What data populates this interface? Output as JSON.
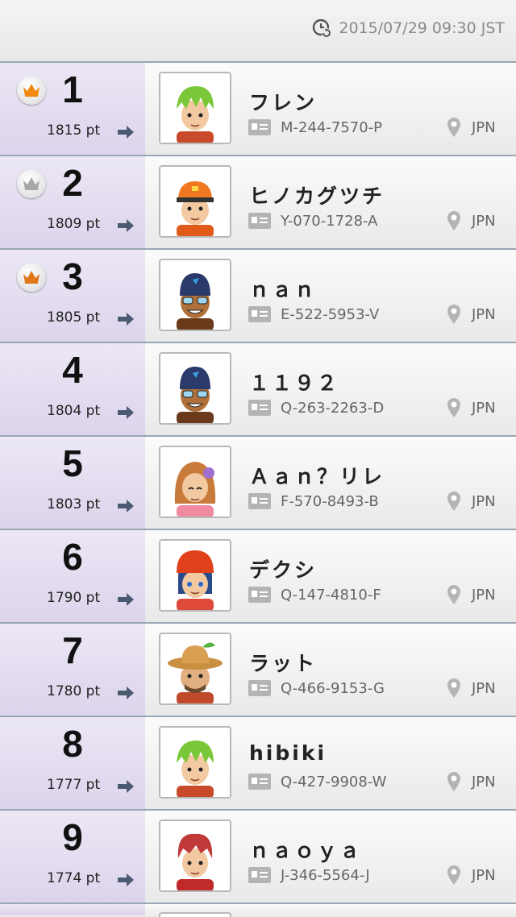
{
  "header": {
    "timestamp": "2015/07/29 09:30 JST",
    "icon": "clock-refresh-icon"
  },
  "colors": {
    "gold_crown": "#f08a10",
    "silver_crown": "#a8a8a8",
    "bronze_crown": "#e07818",
    "rank_bg": "#e3ddf0",
    "divider": "#9aa6b4"
  },
  "rankings": [
    {
      "rank": "1",
      "points": "1815 pt",
      "name": "フレン",
      "id": "M-244-7570-P",
      "country": "JPN",
      "crown": "gold",
      "avatar": "green-hair-boy"
    },
    {
      "rank": "2",
      "points": "1809 pt",
      "name": "ヒノカグツチ",
      "id": "Y-070-1728-A",
      "country": "JPN",
      "crown": "silver",
      "avatar": "orange-cap-boy"
    },
    {
      "rank": "3",
      "points": "1805 pt",
      "name": "ｎａｎ",
      "id": "E-522-5953-V",
      "country": "JPN",
      "crown": "bronze",
      "avatar": "swimmer-goggles"
    },
    {
      "rank": "4",
      "points": "1804 pt",
      "name": "１１９２",
      "id": "Q-263-2263-D",
      "country": "JPN",
      "crown": "",
      "avatar": "swimmer-goggles"
    },
    {
      "rank": "5",
      "points": "1803 pt",
      "name": "Ａａｎ？リレ",
      "id": "F-570-8493-B",
      "country": "JPN",
      "crown": "",
      "avatar": "flower-girl"
    },
    {
      "rank": "6",
      "points": "1790 pt",
      "name": "デクシ",
      "id": "Q-147-4810-F",
      "country": "JPN",
      "crown": "",
      "avatar": "red-beanie-girl"
    },
    {
      "rank": "7",
      "points": "1780 pt",
      "name": "ラット",
      "id": "Q-466-9153-G",
      "country": "JPN",
      "crown": "",
      "avatar": "hiker-hat"
    },
    {
      "rank": "8",
      "points": "1777 pt",
      "name": "hibiki",
      "id": "Q-427-9908-W",
      "country": "JPN",
      "crown": "",
      "avatar": "green-hair-boy"
    },
    {
      "rank": "9",
      "points": "1774 pt",
      "name": "ｎａｏｙａ",
      "id": "J-346-5564-J",
      "country": "JPN",
      "crown": "",
      "avatar": "red-hair-boy"
    }
  ]
}
